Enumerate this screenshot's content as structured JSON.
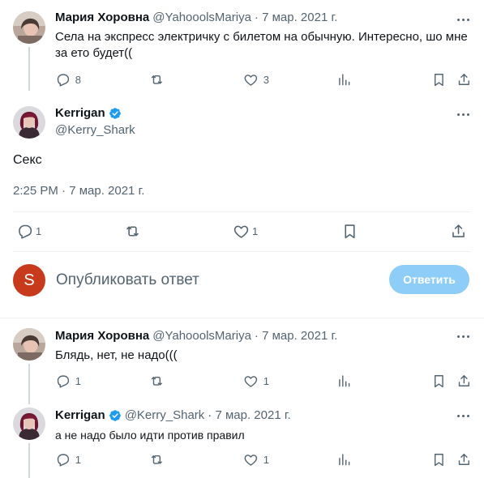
{
  "tweet1": {
    "name": "Мария Хоровна",
    "handle": "@YahooolsMariya",
    "date": "· 7 мар. 2021 г.",
    "text_line1": "Села на экспресс электричку с билетом на обычную. Интересно, шо мне",
    "text_line2": "за ето будет((",
    "replies": "8",
    "retweets": "",
    "likes": "3"
  },
  "main_tweet": {
    "name": "Kerrigan",
    "handle": "@Kerry_Shark",
    "text": "Секс",
    "timestamp": "2:25 PM · 7 мар. 2021 г.",
    "replies": "1",
    "retweets": "",
    "likes": "1"
  },
  "compose": {
    "avatar_letter": "S",
    "placeholder": "Опубликовать ответ",
    "button_label": "Ответить",
    "button_color": "#8ecdf8",
    "avatar_color": "#c73a1c"
  },
  "reply1": {
    "name": "Мария Хоровна",
    "handle": "@YahooolsMariya",
    "date": "· 7 мар. 2021 г.",
    "text": "Блядь, нет, не надо(((",
    "replies": "1",
    "retweets": "",
    "likes": "1"
  },
  "reply2": {
    "name": "Kerrigan",
    "handle": "@Kerry_Shark",
    "date": "· 7 мар. 2021 г.",
    "text": "а не надо было идти против правил",
    "replies": "1",
    "retweets": "",
    "likes": "1"
  },
  "colors": {
    "verified": "#1d9bf0",
    "muted": "#536471",
    "line": "#cfd9de"
  },
  "icons": [
    "reply-icon",
    "retweet-icon",
    "like-icon",
    "views-icon",
    "bookmark-icon",
    "share-icon",
    "more-icon",
    "verified-icon"
  ]
}
